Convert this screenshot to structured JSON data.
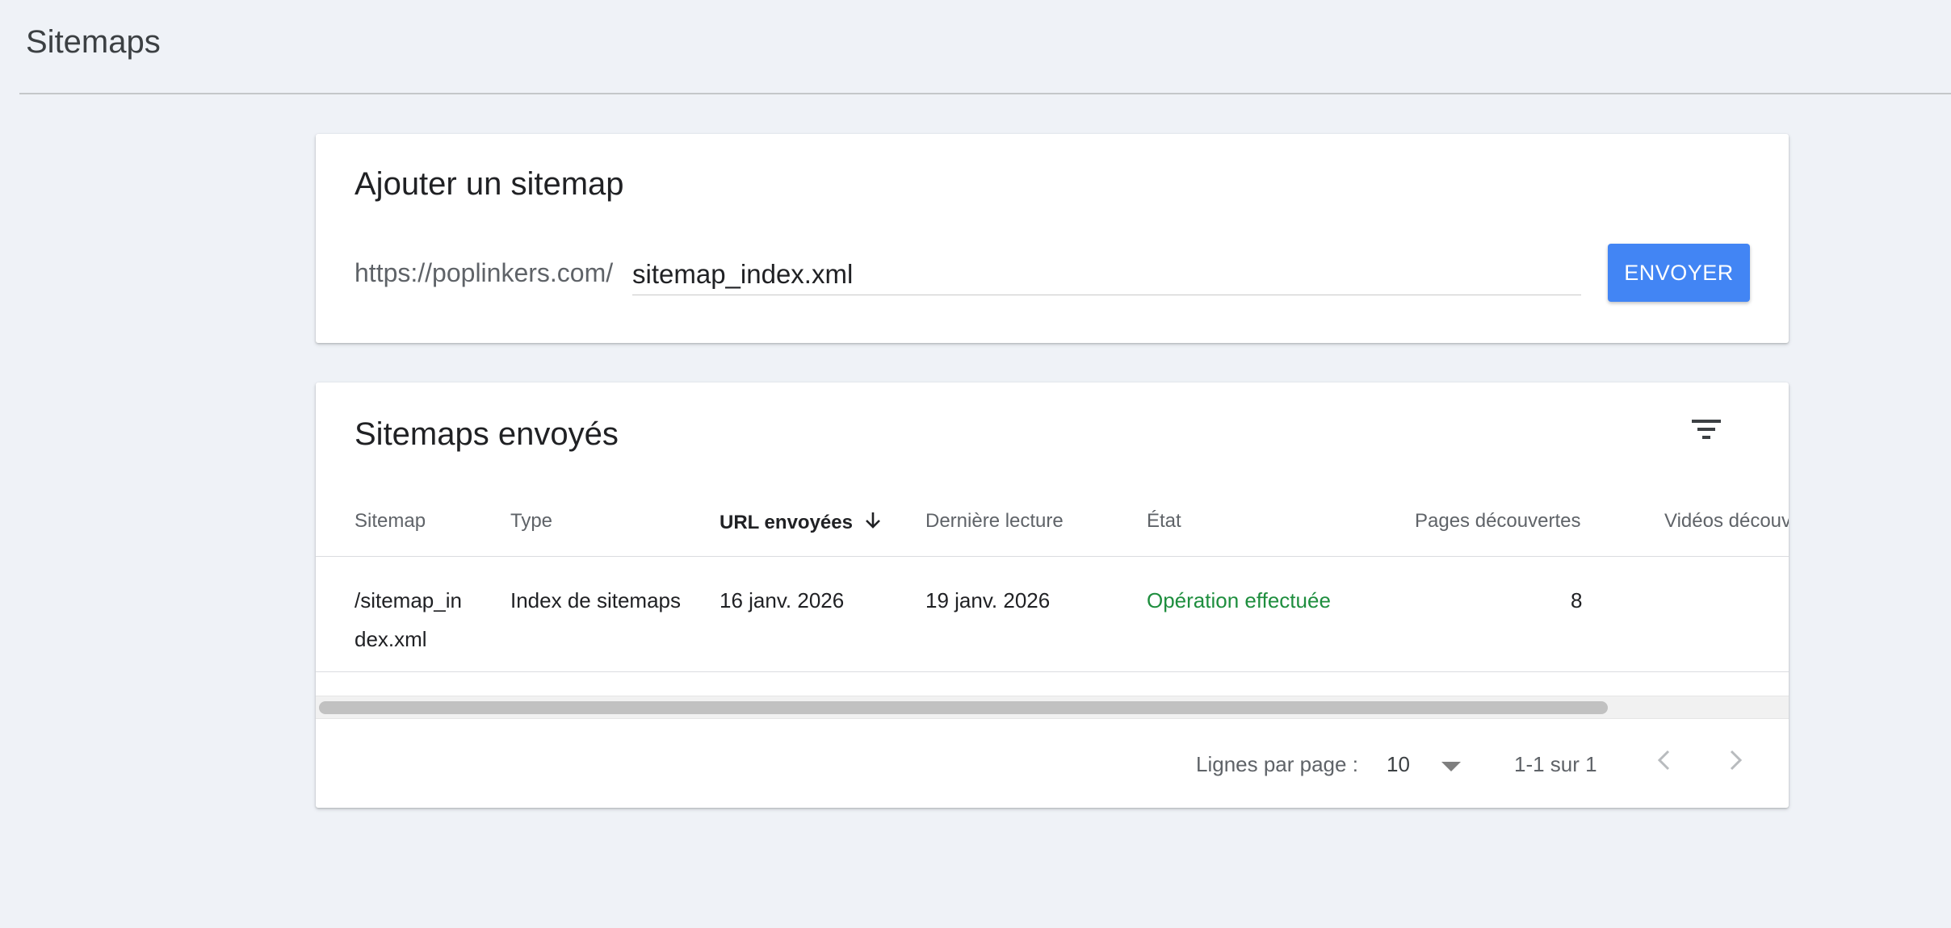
{
  "header": {
    "title": "Sitemaps"
  },
  "add_sitemap": {
    "title": "Ajouter un sitemap",
    "url_prefix": "https://poplinkers.com/",
    "input_value": "sitemap_index.xml",
    "submit_label": "ENVOYER",
    "accent_color": "#4285f4"
  },
  "submitted": {
    "title": "Sitemaps envoyés",
    "filter_icon": "filter-list-icon",
    "columns": [
      {
        "label": "Sitemap"
      },
      {
        "label": "Type"
      },
      {
        "label": "URL envoyées",
        "sorted": "descending"
      },
      {
        "label": "Dernière lecture"
      },
      {
        "label": "État"
      },
      {
        "label": "Pages découvertes"
      },
      {
        "label": "Vidéos découv"
      }
    ],
    "rows": [
      {
        "sitemap": "/sitemap_in dex.xml",
        "sitemap_line1": "/sitemap_in",
        "sitemap_line2": "dex.xml",
        "type": "Index de sitemaps",
        "submitted": "16 janv. 2026",
        "last_read": "19 janv. 2026",
        "status": "Opération effectuée",
        "status_color": "#1e8e3e",
        "pages_discovered": "8",
        "videos_discovered": ""
      }
    ],
    "pagination": {
      "rows_per_page_label": "Lignes par page :",
      "rows_per_page_value": "10",
      "range_text": "1-1 sur 1",
      "prev_icon": "chevron-left-icon",
      "next_icon": "chevron-right-icon"
    }
  }
}
